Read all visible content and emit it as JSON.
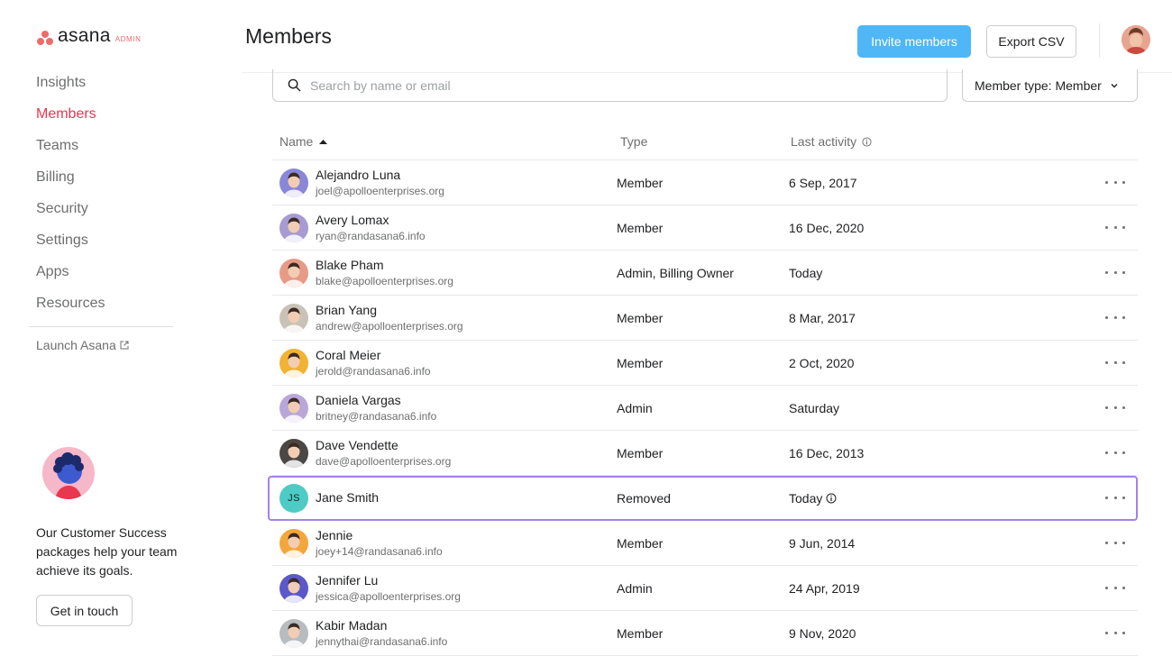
{
  "brand": {
    "name": "asana",
    "badge": "ADMIN"
  },
  "sidebar": {
    "items": [
      {
        "label": "Insights",
        "active": false
      },
      {
        "label": "Members",
        "active": true
      },
      {
        "label": "Teams",
        "active": false
      },
      {
        "label": "Billing",
        "active": false
      },
      {
        "label": "Security",
        "active": false
      },
      {
        "label": "Settings",
        "active": false
      },
      {
        "label": "Apps",
        "active": false
      },
      {
        "label": "Resources",
        "active": false
      }
    ],
    "launch_label": "Launch Asana",
    "promo_text": "Our Customer Success packages help your team achieve its goals.",
    "promo_button": "Get in touch"
  },
  "header": {
    "title": "Members",
    "invite_label": "Invite members",
    "export_label": "Export CSV"
  },
  "search": {
    "placeholder": "Search by name or email",
    "value": ""
  },
  "filter": {
    "label": "Member type: Member"
  },
  "table": {
    "columns": {
      "name": "Name",
      "type": "Type",
      "activity": "Last activity"
    },
    "sort": {
      "column": "name",
      "direction": "ascending"
    },
    "rows": [
      {
        "name": "Alejandro Luna",
        "email": "joel@apolloenterprises.org",
        "type": "Member",
        "activity": "6 Sep, 2017",
        "avatar_color": "#8a86d8",
        "highlighted": false
      },
      {
        "name": "Avery Lomax",
        "email": "ryan@randasana6.info",
        "type": "Member",
        "activity": "16 Dec, 2020",
        "avatar_color": "#a79bd2",
        "highlighted": false
      },
      {
        "name": "Blake Pham",
        "email": "blake@apolloenterprises.org",
        "type": "Admin, Billing Owner",
        "activity": "Today",
        "avatar_color": "#e79a86",
        "highlighted": false
      },
      {
        "name": "Brian Yang",
        "email": "andrew@apolloenterprises.org",
        "type": "Member",
        "activity": "8 Mar, 2017",
        "avatar_color": "#c9c2b6",
        "highlighted": false
      },
      {
        "name": "Coral Meier",
        "email": "jerold@randasana6.info",
        "type": "Member",
        "activity": "2 Oct, 2020",
        "avatar_color": "#f2b233",
        "highlighted": false
      },
      {
        "name": "Daniela Vargas",
        "email": "britney@randasana6.info",
        "type": "Admin",
        "activity": "Saturday",
        "avatar_color": "#b9a7d9",
        "highlighted": false
      },
      {
        "name": "Dave Vendette",
        "email": "dave@apolloenterprises.org",
        "type": "Member",
        "activity": "16 Dec, 2013",
        "avatar_color": "#4a4744",
        "highlighted": false
      },
      {
        "name": "Jane Smith",
        "email": "",
        "initials": "JS",
        "type": "Removed",
        "activity": "Today",
        "activity_info": true,
        "avatar_color": "#4ecbc4",
        "highlighted": true
      },
      {
        "name": "Jennie",
        "email": "joey+14@randasana6.info",
        "type": "Member",
        "activity": "9 Jun, 2014",
        "avatar_color": "#f4a63a",
        "highlighted": false
      },
      {
        "name": "Jennifer Lu",
        "email": "jessica@apolloenterprises.org",
        "type": "Admin",
        "activity": "24 Apr, 2019",
        "avatar_color": "#5b58c9",
        "highlighted": false
      },
      {
        "name": "Kabir Madan",
        "email": "jennythai@randasana6.info",
        "type": "Member",
        "activity": "9 Nov, 2020",
        "avatar_color": "#b7bcc0",
        "highlighted": false
      }
    ]
  },
  "colors": {
    "accent": "#e8384f",
    "primary_button": "#4fb7f5",
    "highlight_border": "#a581e8"
  }
}
